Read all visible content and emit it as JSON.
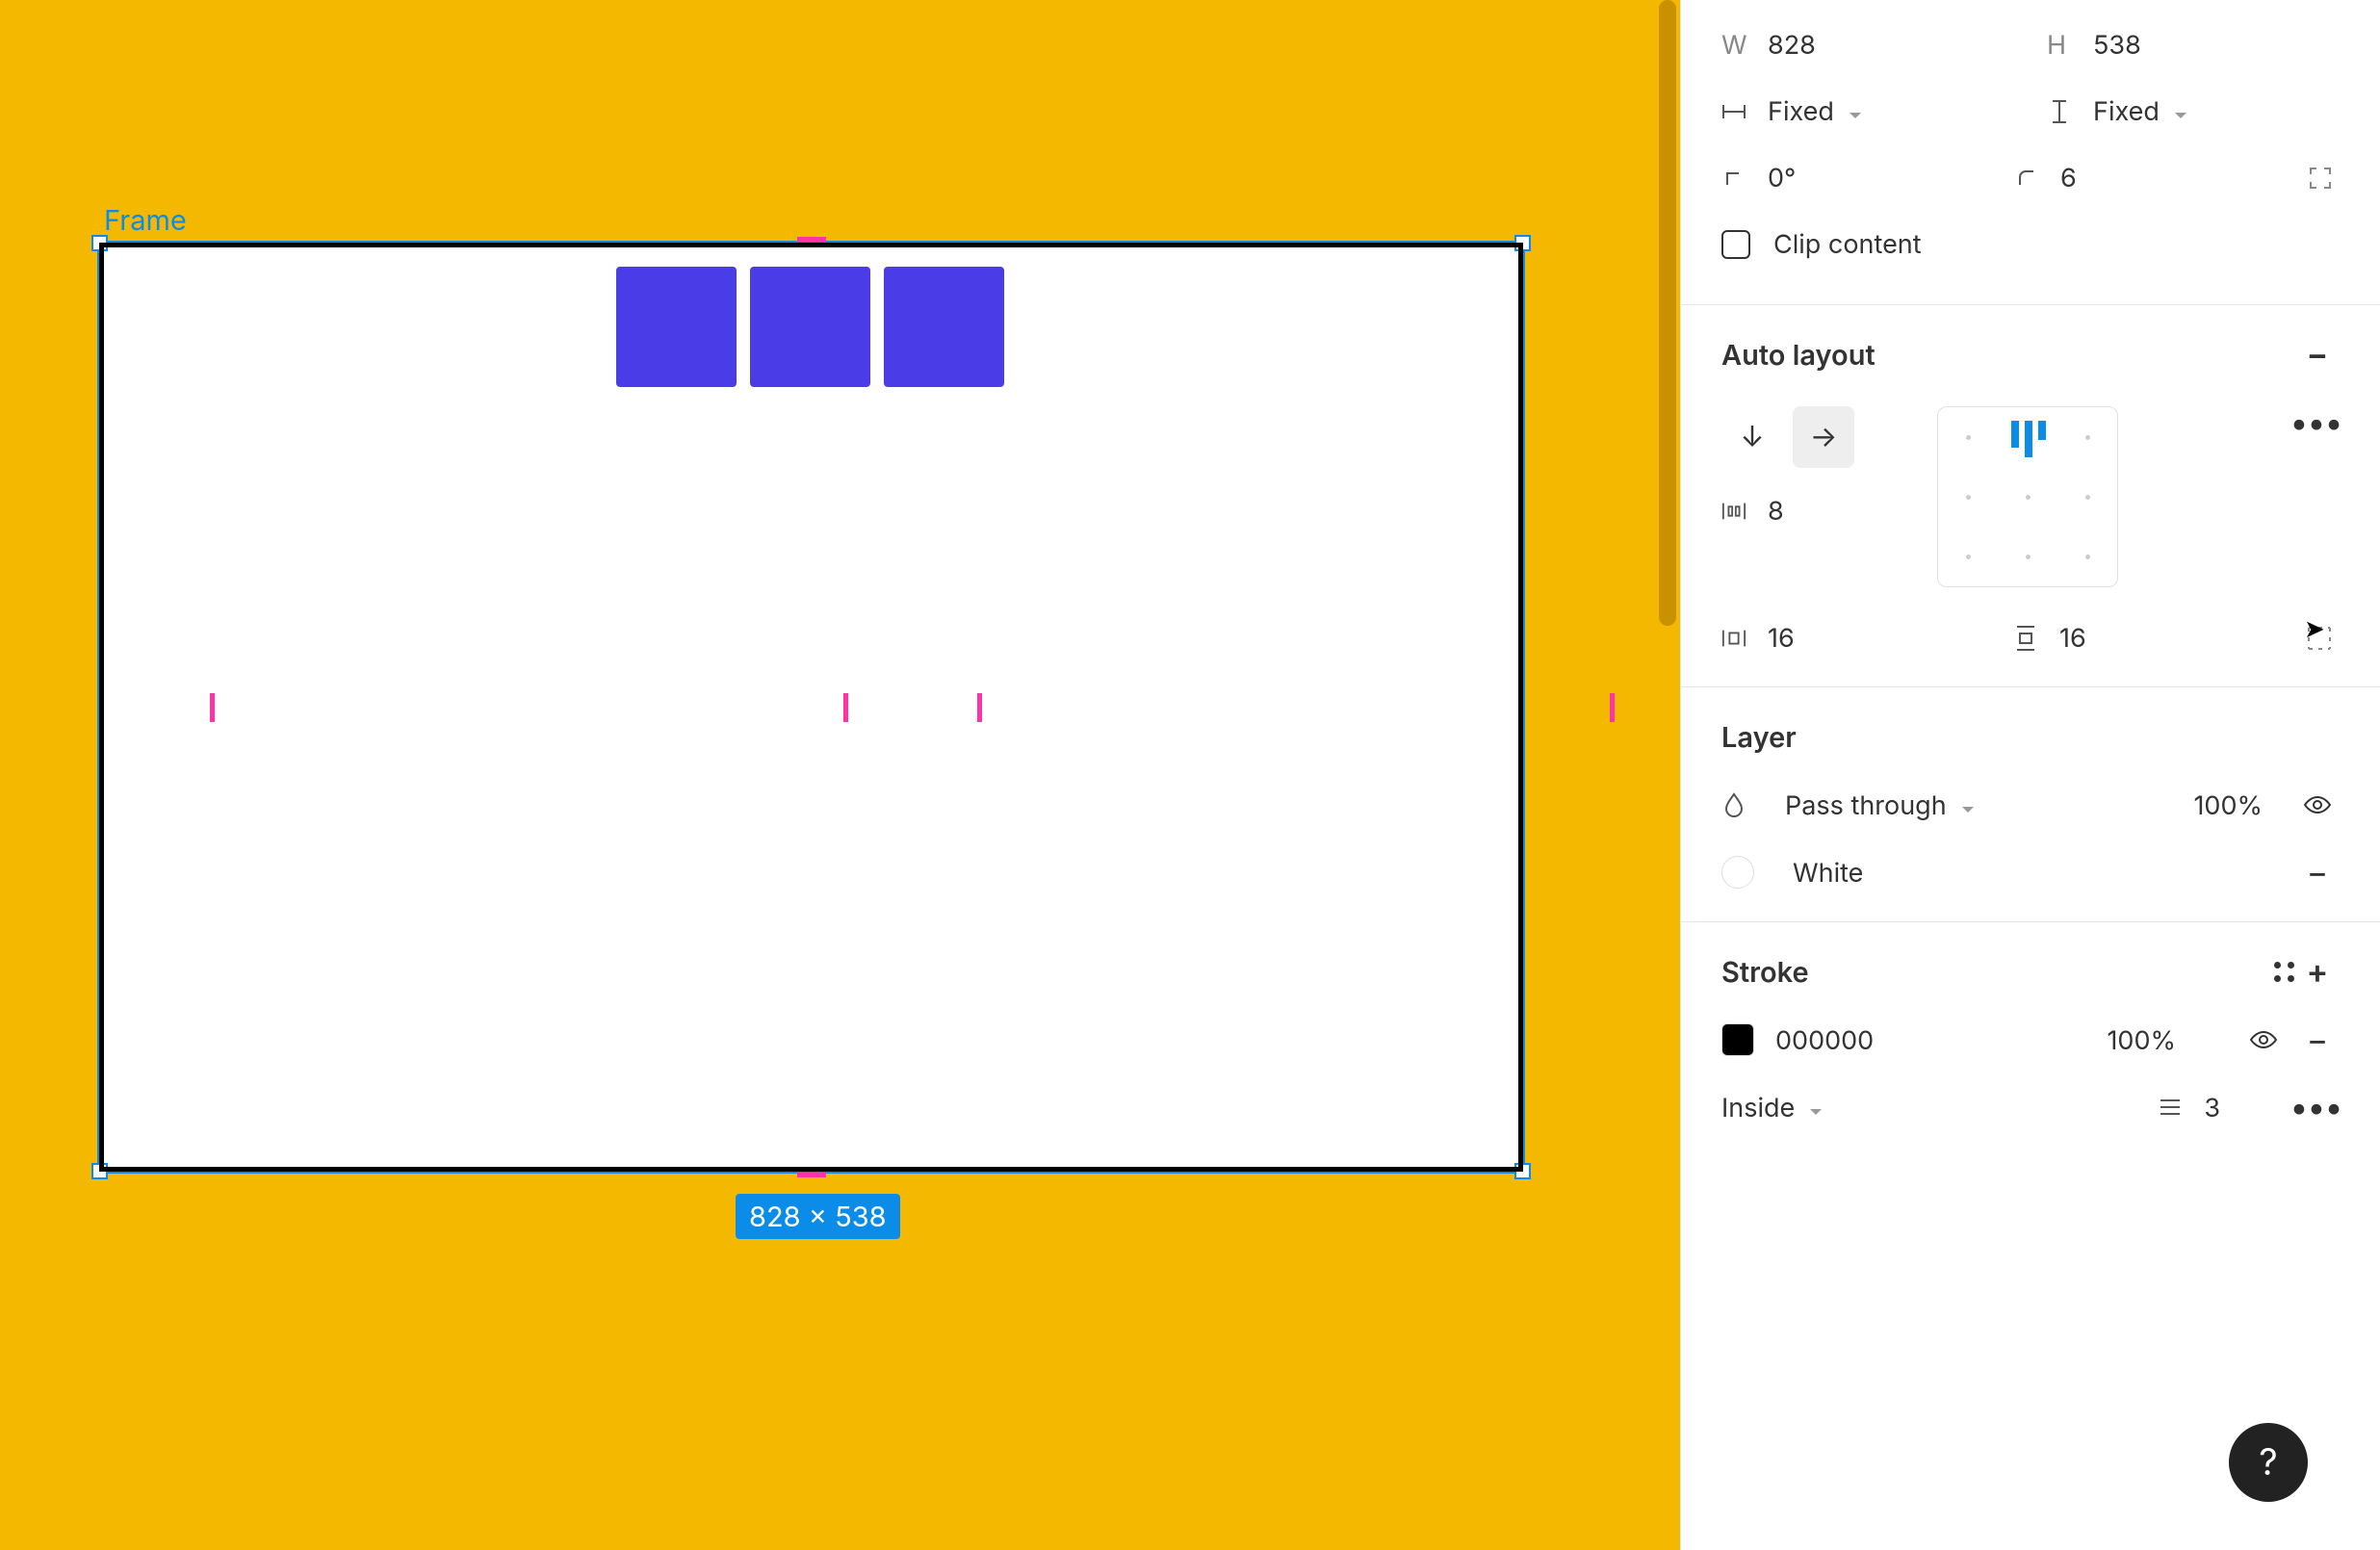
{
  "canvas": {
    "frame_label": "Frame",
    "dim_badge": "828 × 538"
  },
  "size": {
    "w_label": "W",
    "w_value": "828",
    "h_label": "H",
    "h_value": "538",
    "hresize": "Fixed",
    "vresize": "Fixed",
    "rotation": "0°",
    "corner_radius": "6",
    "clip_content": "Clip content"
  },
  "autolayout": {
    "title": "Auto layout",
    "gap": "8",
    "pad_h": "16",
    "pad_v": "16"
  },
  "layer": {
    "title": "Layer",
    "blend": "Pass through",
    "opacity": "100%",
    "fill_name": "White"
  },
  "stroke": {
    "title": "Stroke",
    "color": "000000",
    "opacity": "100%",
    "position": "Inside",
    "weight": "3"
  }
}
